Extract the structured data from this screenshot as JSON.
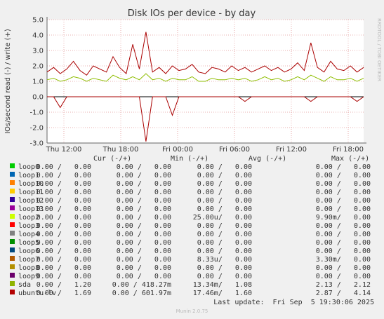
{
  "chart_data": {
    "type": "line",
    "title": "Disk IOs per device - by day",
    "ylabel": "IOs/second read (-) / write (+)",
    "ylim": [
      -3.0,
      5.0
    ],
    "yticks": [
      "5.0",
      "4.0",
      "3.0",
      "2.0",
      "1.0",
      "0.0",
      "-1.0",
      "-2.0",
      "-3.0"
    ],
    "xticks": [
      "Thu 12:00",
      "Thu 18:00",
      "Fri 00:00",
      "Fri 06:00",
      "Fri 12:00",
      "Fri 18:00"
    ],
    "grid": true,
    "series": [
      {
        "name": "ubuntu-lv",
        "color": "#aa0000",
        "write": [
          1.6,
          1.9,
          1.5,
          1.8,
          2.3,
          1.7,
          1.4,
          2.0,
          1.8,
          1.6,
          2.6,
          1.9,
          1.5,
          3.4,
          1.8,
          4.2,
          1.6,
          1.9,
          1.5,
          2.0,
          1.7,
          1.8,
          2.1,
          1.6,
          1.5,
          1.9,
          1.8,
          1.6,
          2.0,
          1.7,
          1.9,
          1.6,
          1.8,
          2.0,
          1.7,
          1.9,
          1.6,
          1.8,
          2.2,
          1.7,
          3.5,
          1.9,
          1.6,
          2.3,
          1.8,
          1.7,
          2.0,
          1.6,
          1.9
        ],
        "read": [
          0,
          0,
          -0.7,
          0,
          0,
          0,
          0,
          0,
          0,
          0,
          0,
          0,
          0,
          0,
          0,
          -2.9,
          0,
          0,
          0,
          -1.2,
          0,
          0,
          0,
          0,
          0,
          0,
          0,
          0,
          0,
          0,
          -0.3,
          0,
          0,
          0,
          0,
          0,
          0,
          0,
          0,
          0,
          -0.3,
          0,
          0,
          0,
          0,
          0,
          0,
          -0.3,
          0
        ]
      },
      {
        "name": "sda",
        "color": "#8ebd00",
        "write": [
          1.1,
          1.2,
          1.0,
          1.1,
          1.3,
          1.2,
          1.0,
          1.2,
          1.1,
          1.0,
          1.4,
          1.2,
          1.1,
          1.3,
          1.1,
          1.5,
          1.1,
          1.2,
          1.0,
          1.2,
          1.1,
          1.1,
          1.3,
          1.0,
          1.0,
          1.2,
          1.1,
          1.1,
          1.2,
          1.1,
          1.2,
          1.0,
          1.1,
          1.3,
          1.1,
          1.2,
          1.0,
          1.1,
          1.3,
          1.1,
          1.4,
          1.2,
          1.0,
          1.3,
          1.1,
          1.1,
          1.2,
          1.0,
          1.2
        ],
        "read": []
      }
    ],
    "legend": {
      "headers": [
        "Cur (-/+)",
        "Min (-/+)",
        "Avg (-/+)",
        "Max (-/+)"
      ],
      "rows": [
        {
          "name": "loop0",
          "color": "#00cc00",
          "cur": "0.00 /   0.00",
          "min": "0.00 /   0.00",
          "avg": "0.00 /   0.00",
          "max": "0.00 /   0.00"
        },
        {
          "name": "loop1",
          "color": "#0066b3",
          "cur": "0.00 /   0.00",
          "min": "0.00 /   0.00",
          "avg": "0.00 /   0.00",
          "max": "0.00 /   0.00"
        },
        {
          "name": "loop10",
          "color": "#ff8000",
          "cur": "0.00 /   0.00",
          "min": "0.00 /   0.00",
          "avg": "0.00 /   0.00",
          "max": "0.00 /   0.00"
        },
        {
          "name": "loop11",
          "color": "#ffcc00",
          "cur": "0.00 /   0.00",
          "min": "0.00 /   0.00",
          "avg": "0.00 /   0.00",
          "max": "0.00 /   0.00"
        },
        {
          "name": "loop12",
          "color": "#330099",
          "cur": "0.00 /   0.00",
          "min": "0.00 /   0.00",
          "avg": "0.00 /   0.00",
          "max": "0.00 /   0.00"
        },
        {
          "name": "loop13",
          "color": "#990099",
          "cur": "0.00 /   0.00",
          "min": "0.00 /   0.00",
          "avg": "0.00 /   0.00",
          "max": "0.00 /   0.00"
        },
        {
          "name": "loop2",
          "color": "#ccff00",
          "cur": "0.00 /   0.00",
          "min": "0.00 /   0.00",
          "avg": "25.00u/   0.00",
          "max": "9.90m/   0.00"
        },
        {
          "name": "loop3",
          "color": "#ff0000",
          "cur": "0.00 /   0.00",
          "min": "0.00 /   0.00",
          "avg": "0.00 /   0.00",
          "max": "0.00 /   0.00"
        },
        {
          "name": "loop4",
          "color": "#808080",
          "cur": "0.00 /   0.00",
          "min": "0.00 /   0.00",
          "avg": "0.00 /   0.00",
          "max": "0.00 /   0.00"
        },
        {
          "name": "loop5",
          "color": "#008f00",
          "cur": "0.00 /   0.00",
          "min": "0.00 /   0.00",
          "avg": "0.00 /   0.00",
          "max": "0.00 /   0.00"
        },
        {
          "name": "loop6",
          "color": "#00487d",
          "cur": "0.00 /   0.00",
          "min": "0.00 /   0.00",
          "avg": "0.00 /   0.00",
          "max": "0.00 /   0.00"
        },
        {
          "name": "loop7",
          "color": "#b35a00",
          "cur": "0.00 /   0.00",
          "min": "0.00 /   0.00",
          "avg": "8.33u/   0.00",
          "max": "3.30m/   0.00"
        },
        {
          "name": "loop8",
          "color": "#b38f00",
          "cur": "0.00 /   0.00",
          "min": "0.00 /   0.00",
          "avg": "0.00 /   0.00",
          "max": "0.00 /   0.00"
        },
        {
          "name": "loop9",
          "color": "#6b006b",
          "cur": "0.00 /   0.00",
          "min": "0.00 /   0.00",
          "avg": "0.00 /   0.00",
          "max": "0.00 /   0.00"
        },
        {
          "name": "sda",
          "color": "#8fb300",
          "cur": "0.00 /   1.20",
          "min": "0.00 / 418.27m",
          "avg": "13.34m/   1.08",
          "max": "2.13 /   2.12"
        },
        {
          "name": "ubuntu-lv",
          "color": "#b30000",
          "cur": "0.00 /   1.69",
          "min": "0.00 / 601.97m",
          "avg": "17.46m/   1.60",
          "max": "2.87 /   4.14"
        }
      ]
    }
  },
  "side_label": "RRDTOOL / TOBI OETIKER",
  "last_update": "Last update:  Fri Sep  5 19:30:06 2025",
  "version": "Munin 2.0.75"
}
